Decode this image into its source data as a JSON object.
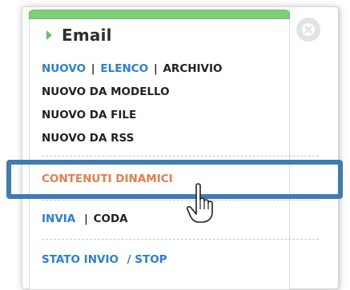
{
  "panel": {
    "title": "Email"
  },
  "menu": {
    "nuovo": "NUOVO",
    "elenco": "ELENCO",
    "archivio": "ARCHIVIO",
    "separator": "|",
    "nuovo_da_modello": "NUOVO DA MODELLO",
    "nuovo_da_file": "NUOVO DA FILE",
    "nuovo_da_rss": "NUOVO DA RSS",
    "contenuti_dinamici": "CONTENUTI DINAMICI",
    "invia": "INVIA",
    "coda": "CODA",
    "stato_invio": "STATO INVIO",
    "stop": "/ STOP"
  },
  "colors": {
    "link_blue": "#2c7fd6",
    "active_orange": "#f07a4a",
    "header_green": "#7fce7a",
    "highlight_blue": "#3e7cb1"
  },
  "icons": {
    "close": "close-icon",
    "arrow": "triangle-right-icon",
    "cursor": "hand-pointer-icon"
  }
}
